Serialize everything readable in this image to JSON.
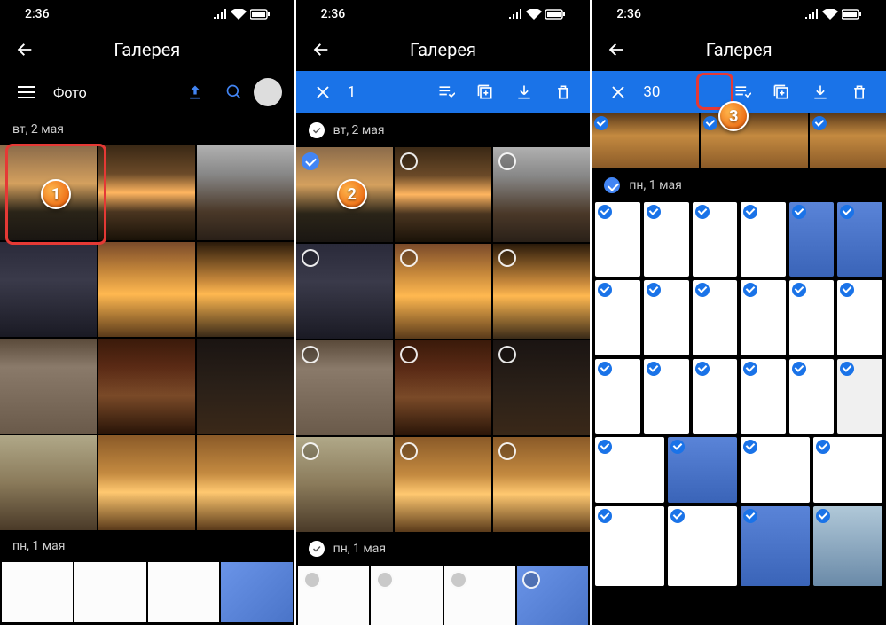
{
  "statusbar": {
    "time": "2:36"
  },
  "appbar": {
    "title": "Галерея"
  },
  "screen1": {
    "toolbar_label": "Фото",
    "date1": "вт, 2 мая",
    "date2": "пн, 1 мая"
  },
  "screen2": {
    "count": "1",
    "date1": "вт, 2 мая",
    "date2": "пн, 1 мая"
  },
  "screen3": {
    "count": "30",
    "date1": "пн, 1 мая"
  },
  "badges": {
    "b1": "1",
    "b2": "2",
    "b3": "3"
  }
}
